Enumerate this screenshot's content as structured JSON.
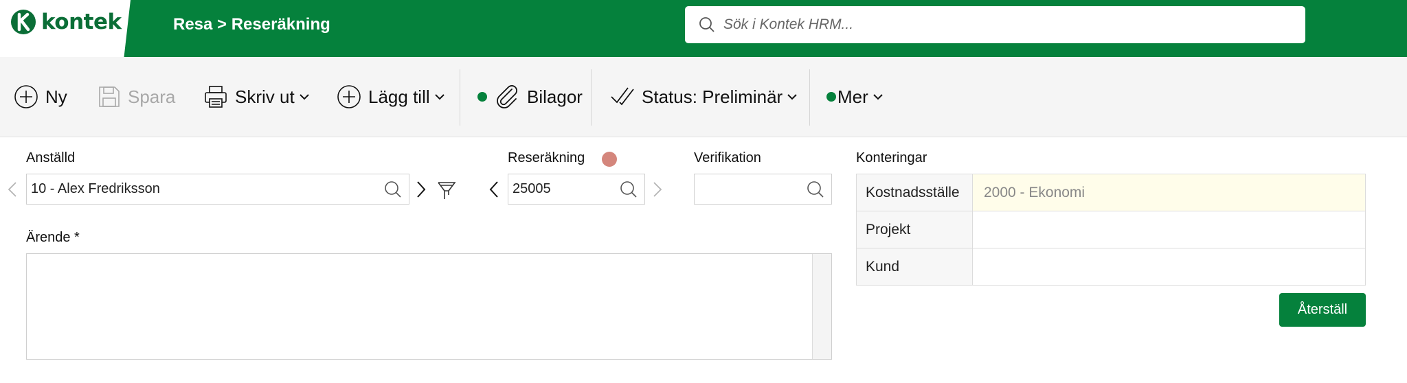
{
  "brand": {
    "name": "kontek",
    "color": "#05813c"
  },
  "header": {
    "breadcrumb": "Resa > Reseräkning",
    "search_placeholder": "Sök i Kontek HRM..."
  },
  "toolbar": {
    "new_label": "Ny",
    "save_label": "Spara",
    "print_label": "Skriv ut",
    "add_label": "Lägg till",
    "attachments_label": "Bilagor",
    "status_label": "Status: Preliminär",
    "more_label": "Mer"
  },
  "form": {
    "employee": {
      "label": "Anställd",
      "value": "10 - Alex Fredriksson"
    },
    "expense_report": {
      "label": "Reseräkning",
      "value": "25005",
      "status_color": "#d4867c"
    },
    "verification": {
      "label": "Verifikation",
      "value": ""
    },
    "subject": {
      "label": "Ärende *",
      "value": ""
    }
  },
  "postings": {
    "title": "Konteringar",
    "rows": [
      {
        "key": "Kostnadsställe",
        "value": "2000 - Ekonomi"
      },
      {
        "key": "Projekt",
        "value": ""
      },
      {
        "key": "Kund",
        "value": ""
      }
    ],
    "reset_label": "Återställ"
  }
}
